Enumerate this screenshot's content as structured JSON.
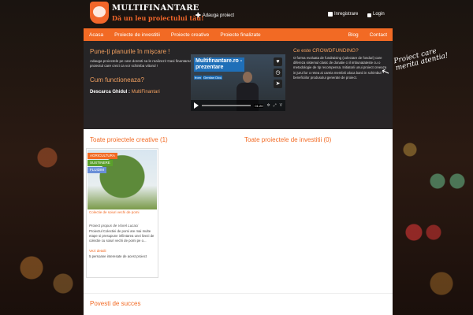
{
  "header": {
    "logo_title": "MULTIFINANTARE",
    "logo_subtitle": "Dă un leu proiectului tău!",
    "add_project": "Adauga proiect",
    "register": "Inregistrare",
    "login": "Login"
  },
  "nav": {
    "left": [
      "Acasa",
      "Proiecte de investitii",
      "Proiecte creative",
      "Proiecte finalizate"
    ],
    "right": [
      "Blog",
      "Contact"
    ]
  },
  "hero": {
    "heading": "Pune-ți planurile în mișcare !",
    "paragraph": "Adauga proiectele pe care doresti sa le realizezi! Gasi finantarea proiectul care crezi ca vor schimba viitorul !",
    "how_heading": "Cum functioneaza?",
    "download_prefix": "Descarca Ghidul :",
    "download_link": "MultiFinantari",
    "video_title": "Multifinantare.ro - prezentare",
    "video_by_prefix": "from",
    "video_by": "Gentian Dicu",
    "video_time": "01:20",
    "what_heading": "Ce este CROWDFUNDING?",
    "what_text": "O forma evoluata de fundraising (colectare de fonduri) care difereza sistemul clasic de donatie ci il imbunatateste cu o metodologie de tip recompensa. Initiatorii unui proiect creeaza in jurul lor o retea ai careia membrii aloca banii in schimbul beneficiilor produsului generate de proiect."
  },
  "annotation": {
    "line1": "Proiect care",
    "line2": "merita atentia!"
  },
  "sections": {
    "creative_title": "Toate proiectele creative (1)",
    "investment_title": "Toate proiectele de investitii (0)",
    "success_title": "Povesti de succes"
  },
  "card": {
    "tags": [
      "AGRICULTURA",
      "SUSTINERE",
      "FLUIDIM"
    ],
    "tag_colors": [
      "#f26a24",
      "#5aa02c",
      "#6a8fd8"
    ],
    "caption": "Colectie de soiuri vechi de pomi",
    "author": "Proiect propus de Viorel Lucaci",
    "description": "Proiectul Colectiei de pomi are mai multe etape si presupune infiintarea unei livezi de colectie cu soiuri vechi de pomi pe o...",
    "more": "Vezi detalii",
    "interest": "5 persoane interesate de acest proiect"
  },
  "colors": {
    "accent": "#f26a24",
    "video_title_bg": "#1f6fb8"
  },
  "icons": {
    "add": "plus-icon",
    "register": "user-icon",
    "login": "lock-icon",
    "video_like": "heart-icon",
    "video_later": "clock-icon",
    "video_share": "share-icon",
    "video_play": "play-icon"
  }
}
